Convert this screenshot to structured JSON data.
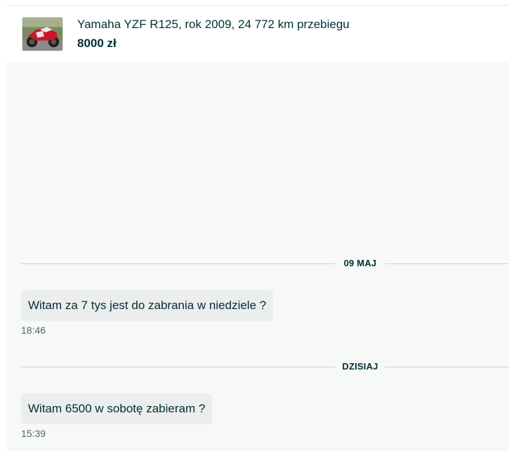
{
  "ad": {
    "title": "Yamaha YZF R125, rok 2009, 24 772 km przebiegu",
    "price": "8000 zł",
    "thumbnail_icon": "motorcycle-photo"
  },
  "conversation": [
    {
      "date_label": "09 MAJ",
      "messages": [
        {
          "text": "Witam za 7 tys jest do zabrania w niedziele ?",
          "time": "18:46"
        }
      ]
    },
    {
      "date_label": "DZISIAJ",
      "messages": [
        {
          "text": "Witam 6500 w sobotę zabieram ?",
          "time": "15:39"
        }
      ]
    }
  ],
  "colors": {
    "text_primary": "#002f34",
    "chat_background": "#f7f8f8",
    "bubble_background": "#eceded"
  }
}
